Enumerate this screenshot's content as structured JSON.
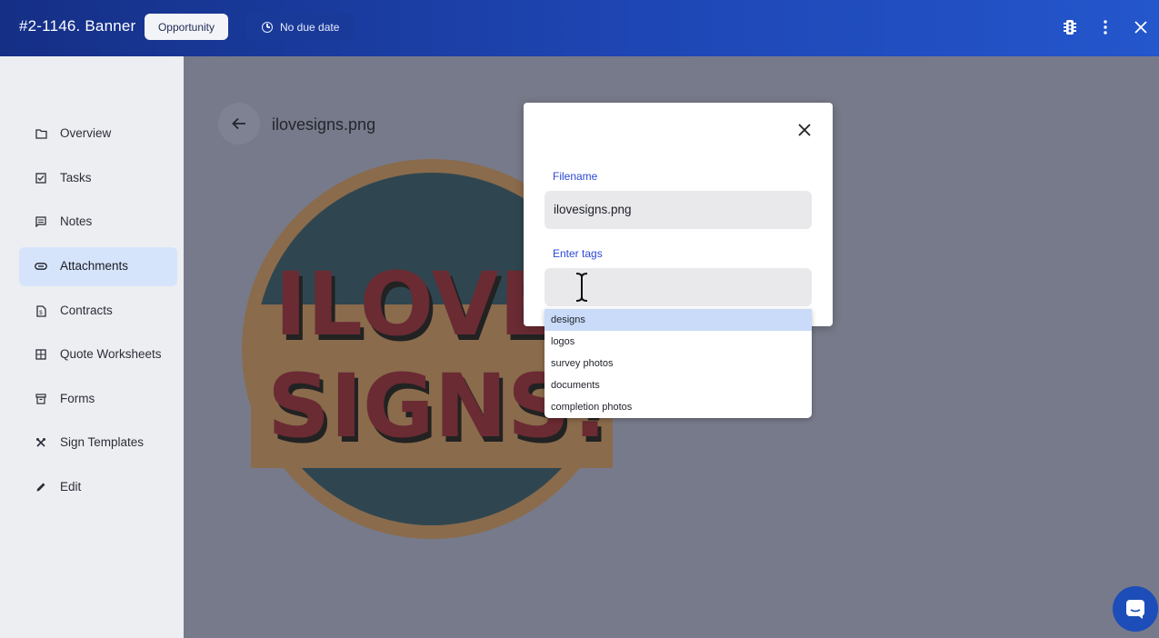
{
  "header": {
    "title": "#2-1146. Banner",
    "type_chip": "Opportunity",
    "due_chip": "No due date",
    "icons": [
      "traffic-light-icon",
      "more-vert-icon",
      "close-icon"
    ]
  },
  "sidebar": {
    "items": [
      {
        "label": "Overview",
        "icon": "folder-icon"
      },
      {
        "label": "Tasks",
        "icon": "checkbox-icon"
      },
      {
        "label": "Notes",
        "icon": "notes-icon"
      },
      {
        "label": "Attachments",
        "icon": "attachment-icon",
        "active": true
      },
      {
        "label": "Contracts",
        "icon": "contract-icon"
      },
      {
        "label": "Quote Worksheets",
        "icon": "calculator-icon"
      },
      {
        "label": "Forms",
        "icon": "archive-icon"
      },
      {
        "label": "Sign Templates",
        "icon": "tools-icon"
      },
      {
        "label": "Edit",
        "icon": "pencil-icon"
      }
    ]
  },
  "main": {
    "file_title": "ilovesigns.png",
    "image_text": [
      "ILOVE",
      "SIGNS!"
    ]
  },
  "modal": {
    "filename_label": "Filename",
    "filename_value": "ilovesigns.png",
    "tags_label": "Enter tags",
    "tags_value": "",
    "tag_options": [
      "designs",
      "logos",
      "survey photos",
      "documents",
      "completion photos"
    ],
    "highlighted_option": "designs"
  },
  "colors": {
    "header_start": "#152f86",
    "header_end": "#2456cc",
    "accent_label": "#2c48d6",
    "active_nav": "#d6e4fb",
    "highlight_option": "#c9dbf8",
    "overlay": "#777a8a"
  }
}
